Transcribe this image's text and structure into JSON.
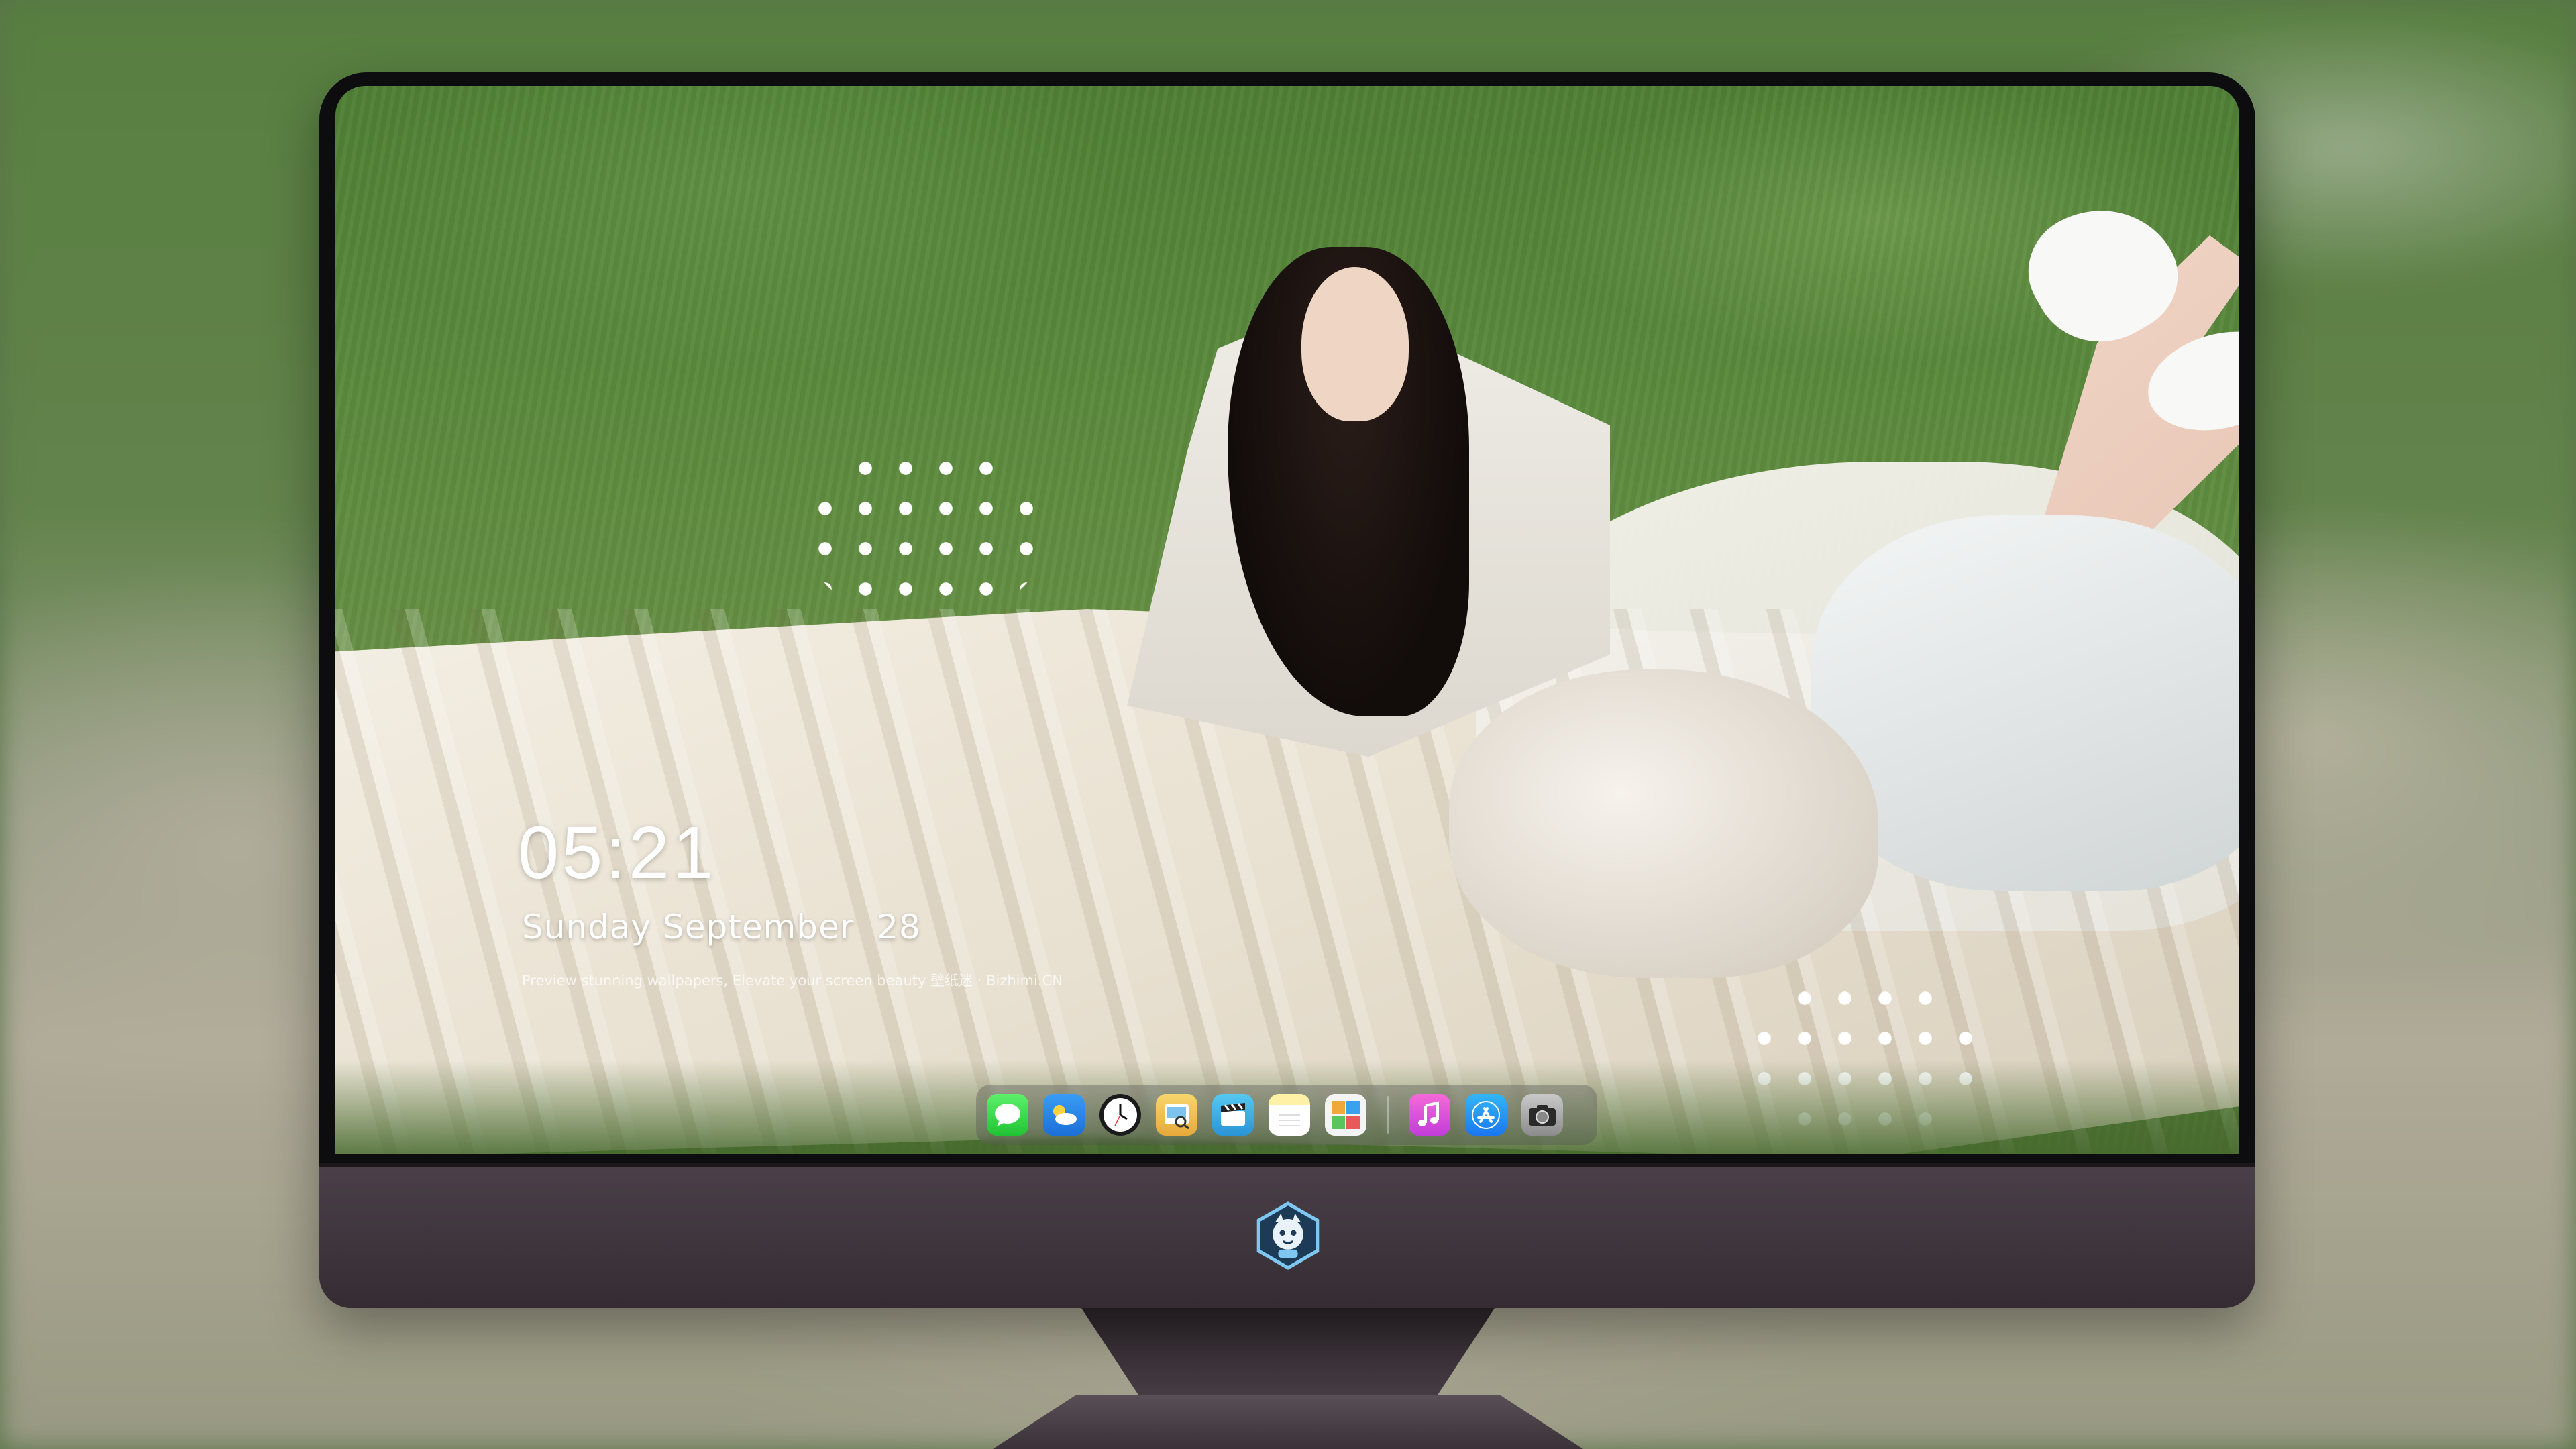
{
  "lock_screen": {
    "time": "05:21",
    "date": "Sunday September  28",
    "caption": "Preview stunning wallpapers, Elevate your screen beauty  壁纸迷 · Bizhimi.CN"
  },
  "dock": {
    "apps": [
      {
        "name": "messages-icon"
      },
      {
        "name": "weather-icon"
      },
      {
        "name": "clock-icon"
      },
      {
        "name": "preview-icon"
      },
      {
        "name": "clips-icon"
      },
      {
        "name": "notes-icon"
      },
      {
        "name": "photo-booth-icon"
      },
      {
        "name": "music-icon"
      },
      {
        "name": "app-store-icon"
      },
      {
        "name": "camera-icon"
      }
    ]
  },
  "colors": {
    "chin": "#3e343c",
    "bezel": "#0d0c0e",
    "clock_text": "#ffffff"
  }
}
